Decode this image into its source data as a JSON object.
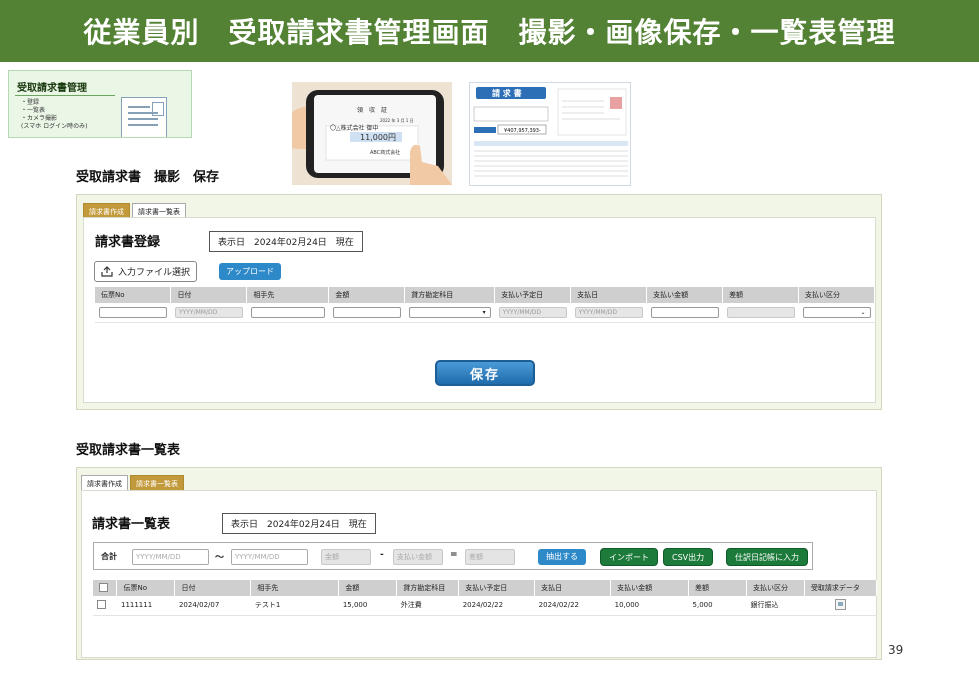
{
  "slide": {
    "title": "従業員別　受取請求書管理画面　撮影・画像保存・一覧表管理",
    "page_number": "39"
  },
  "menu_thumb": {
    "title": "受取請求書管理",
    "items": [
      "・登録",
      "・一覧表",
      "・カメラ撮影",
      "(スマホ ログイン時のみ)"
    ]
  },
  "receipt_photo": {
    "heading": "領　収　証",
    "company": "〇△株式会社 御中",
    "amount": "11,000円",
    "issuer": "ABC商式会社",
    "date": "2022 年 3 月 1 日"
  },
  "invoice_thumb": {
    "heading": "請 求 書",
    "total": "¥407,957,393-"
  },
  "section1": {
    "label": "受取請求書　撮影　保存"
  },
  "register": {
    "tabs": [
      "請求書作成",
      "請求書一覧表"
    ],
    "active_tab": 0,
    "title": "請求書登録",
    "date_label": "表示日　2024年02月24日　現在",
    "file_button": "入力ファイル選択",
    "upload_button": "アップロード",
    "columns": [
      "伝票No",
      "日付",
      "相手先",
      "金額",
      "貸方勘定科目",
      "支払い予定日",
      "支払日",
      "支払い金額",
      "差額",
      "支払い区分"
    ],
    "date_placeholder": "YYYY/MM/DD",
    "save_button": "保存"
  },
  "section2": {
    "label": "受取請求書一覧表"
  },
  "list": {
    "tabs": [
      "請求書作成",
      "請求書一覧表"
    ],
    "active_tab": 1,
    "title": "請求書一覧表",
    "date_label": "表示日　2024年02月24日　現在",
    "filter": {
      "label": "合計",
      "from_placeholder": "YYYY/MM/DD",
      "tilde": "〜",
      "to_placeholder": "YYYY/MM/DD",
      "amount_placeholder": "金額",
      "minus": "-",
      "paid_placeholder": "支払い金額",
      "equals": "=",
      "diff_placeholder": "差額",
      "extract_button": "抽出する"
    },
    "import_button": "インポート",
    "csv_button": "CSV出力",
    "journal_button": "仕訳日記帳に入力",
    "columns": [
      "伝票No",
      "日付",
      "相手先",
      "金額",
      "貸方勘定科目",
      "支払い予定日",
      "支払日",
      "支払い金額",
      "差額",
      "支払い区分",
      "受取請求データ"
    ],
    "rows": [
      {
        "no": "1111111",
        "date": "2024/02/07",
        "partner": "テスト1",
        "amount": "15,000",
        "account": "外注費",
        "due_date": "2024/02/22",
        "paid_date": "2024/02/22",
        "paid_amount": "10,000",
        "diff": "5,000",
        "payment_type": "銀行振込"
      }
    ]
  }
}
